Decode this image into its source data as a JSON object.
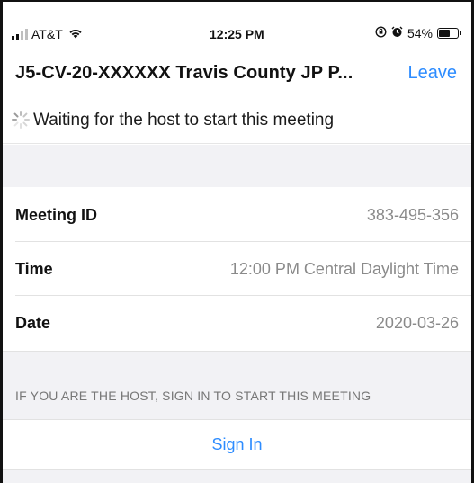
{
  "status_bar": {
    "carrier": "AT&T",
    "time": "12:25 PM",
    "battery": "54%",
    "battery_level": 0.54
  },
  "header": {
    "title": "J5-CV-20-XXXXXX Travis County JP P...",
    "leave_label": "Leave"
  },
  "waiting": {
    "message": "Waiting for the host to start this meeting"
  },
  "details": [
    {
      "label": "Meeting ID",
      "value": "383-495-356"
    },
    {
      "label": "Time",
      "value": "12:00 PM Central Daylight Time"
    },
    {
      "label": "Date",
      "value": "2020-03-26"
    }
  ],
  "host_section": {
    "hint": "IF YOU ARE THE HOST, SIGN IN TO START THIS MEETING",
    "sign_in_label": "Sign In"
  },
  "colors": {
    "accent": "#2d8cff",
    "section_background": "#f2f2f5",
    "value_text": "#8a8a8a"
  }
}
